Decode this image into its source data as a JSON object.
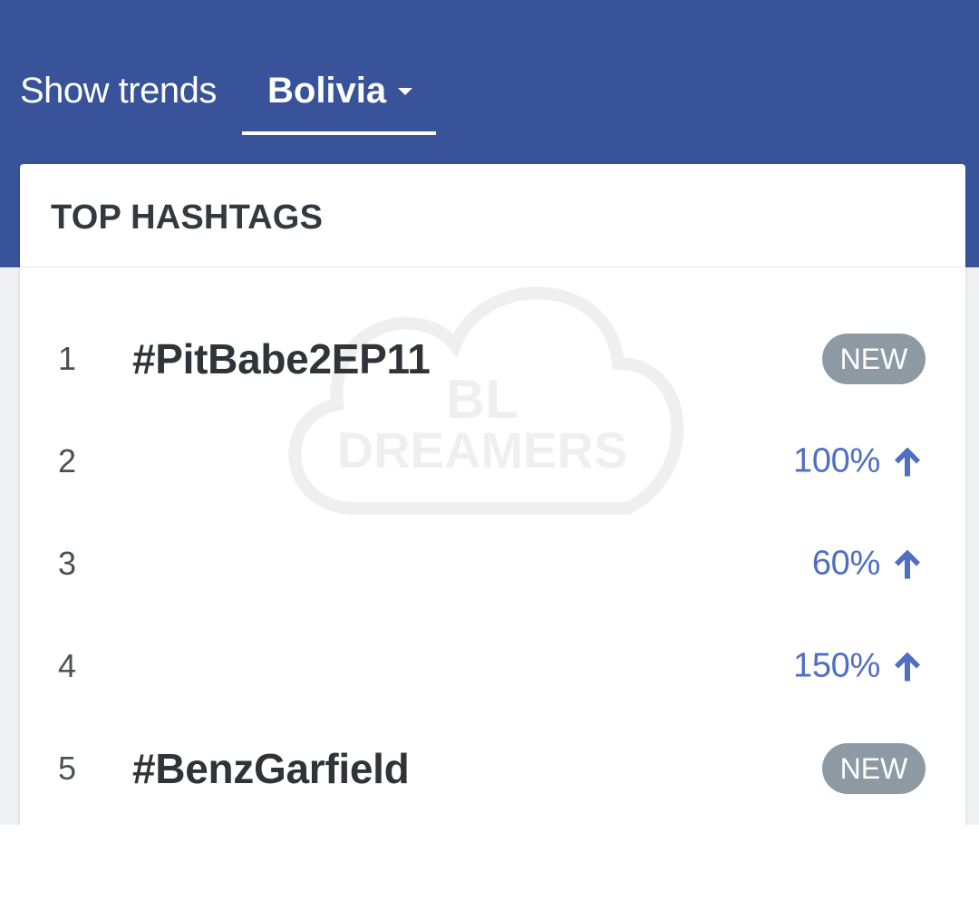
{
  "header": {
    "show_label": "Show trends",
    "country": "Bolivia",
    "country_caret_icon": "caret-down-icon"
  },
  "card": {
    "title": "TOP HASHTAGS",
    "watermark_line1": "BL",
    "watermark_line2": "DREAMERS"
  },
  "hashtags": [
    {
      "rank": "1",
      "tag": "#PitBabe2EP11",
      "badge": "NEW",
      "change": ""
    },
    {
      "rank": "2",
      "tag": "",
      "badge": "",
      "change": "100%"
    },
    {
      "rank": "3",
      "tag": "",
      "badge": "",
      "change": "60%"
    },
    {
      "rank": "4",
      "tag": "",
      "badge": "",
      "change": "150%"
    },
    {
      "rank": "5",
      "tag": "#BenzGarfield",
      "badge": "NEW",
      "change": ""
    }
  ],
  "colors": {
    "header_bg": "#38539a",
    "change_blue": "#4f6ec4",
    "badge_gray": "#8d9aa3"
  }
}
